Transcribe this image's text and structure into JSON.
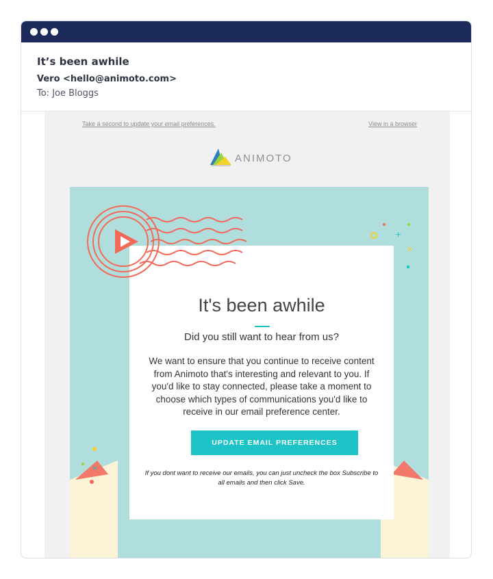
{
  "window": {
    "controls": [
      "dot-icon",
      "dot-icon",
      "dot-icon"
    ]
  },
  "email": {
    "subject": "It’s been awhile",
    "sender": "Vero <hello@animoto.com>",
    "recipient": "To:  Joe Bloggs"
  },
  "body": {
    "top_left_link": "Take a second to update your email preferences.",
    "top_right_link": "View in a browser",
    "logo_text": "ANIMOTO",
    "card": {
      "title": "It's been awhile",
      "subtitle": "Did you still want to hear from us?",
      "paragraph": "We want to ensure that you continue to receive content from Animoto that's interesting and relevant to you. If you'd like to stay connected, please take a moment to choose which types of communications you'd like to receive in our email preference center.",
      "button_label": "UPDATE EMAIL PREFERENCES",
      "fineprint": "If you dont want to receive our emails, you can just uncheck the box Subscribe to all emails and then click Save."
    }
  },
  "colors": {
    "titlebar": "#1b2a5b",
    "hero_background": "#b0dedd",
    "accent": "#1ec3c7",
    "stamp": "#f26a57",
    "envelope": "#fdf3d6"
  }
}
